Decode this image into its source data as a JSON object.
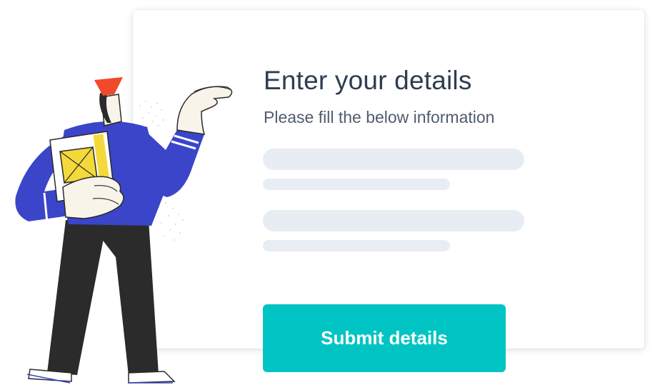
{
  "form": {
    "title": "Enter your details",
    "subtitle": "Please fill the below information",
    "submit_label": "Submit details",
    "fields": [
      {
        "name": "field-1",
        "state": "skeleton-placeholder"
      },
      {
        "name": "field-2",
        "state": "skeleton-placeholder"
      }
    ]
  },
  "colors": {
    "title": "#2e3d50",
    "subtitle": "#4f5d6e",
    "skeleton": "#e8edf3",
    "button": "#00c4c3",
    "button_text": "#ffffff",
    "sweater": "#3a45c9",
    "pants": "#2b2b2b",
    "hat": "#f0492b",
    "card": "#f4d93a"
  },
  "illustration": {
    "icon": "person-holding-card-illustration"
  }
}
